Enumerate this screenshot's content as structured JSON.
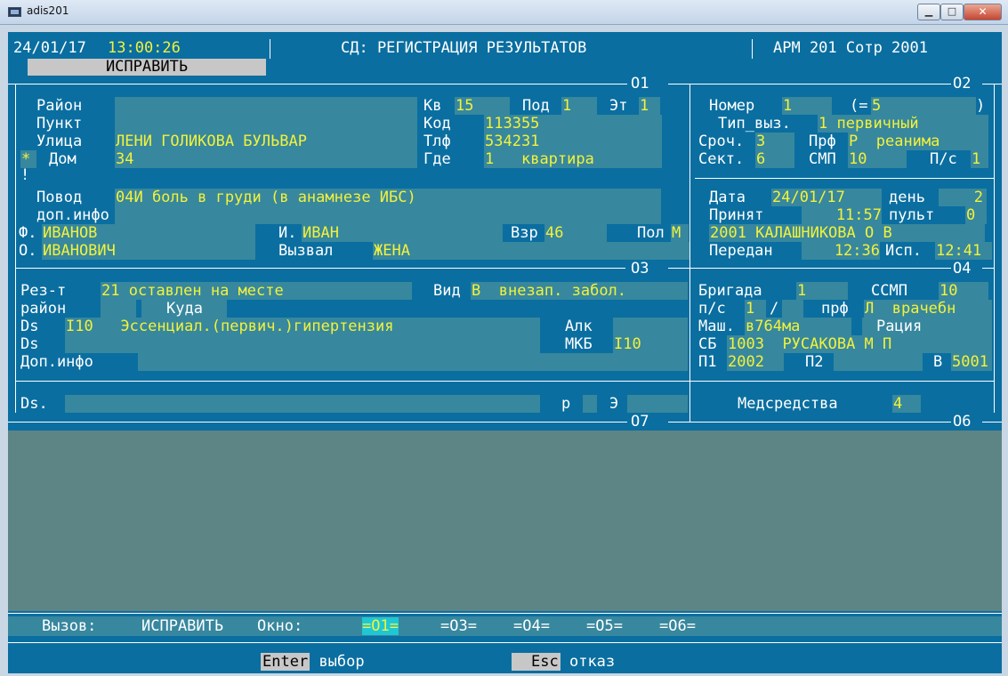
{
  "window": {
    "title": "adis201"
  },
  "header": {
    "date": "24/01/17",
    "time": "13:00:26",
    "mode": "СД: РЕГИСТРАЦИЯ РЕЗУЛЬТАТОВ",
    "workstation": "АРМ 201 Сотр 2001",
    "tab": "ИСПРАВИТЬ"
  },
  "windows": {
    "o1": "О1",
    "o2": "О2",
    "o3": "О3",
    "o4": "О4",
    "o6": "О6",
    "o7": "О7"
  },
  "o1": {
    "rayon_label": "Район",
    "kv_label": "Кв",
    "kv": "15",
    "pod_label": "Под",
    "pod": "1",
    "et_label": "Эт",
    "et": "1",
    "punkt_label": "Пункт",
    "kod_label": "Код",
    "kod": "113355",
    "ulica_label": "Улица",
    "ulica": "ЛЕНИ ГОЛИКОВА БУЛЬВАР",
    "tlf_label": "Тлф",
    "tlf": "534231",
    "star": "*",
    "dom_label": "Дом",
    "dom": "34",
    "gde_label": "Где",
    "gde_code": "1",
    "gde": "квартира",
    "excl": "!",
    "povod_label": "Повод",
    "povod": "04И боль в груди (в анамнезе ИБС)",
    "dop_label": "доп.инфо",
    "f_label": "Ф.",
    "f": "ИВАНОВ",
    "i_label": "И.",
    "i": "ИВАН",
    "vzr_label": "Взр",
    "vzr": "46",
    "pol_label": "Пол",
    "pol": "М",
    "o_label": "О.",
    "o": "ИВАНОВИЧ",
    "vyzval_label": "Вызвал",
    "vyzval": "ЖЕНА"
  },
  "o2": {
    "nomer_label": "Номер",
    "nomer": "1",
    "eq_open": "(=",
    "eq_val": "5",
    "eq_close": ")",
    "tip_label": "Тип_выз.",
    "tip_code": "1",
    "tip": "первичный",
    "sroch_label": "Сроч.",
    "sroch": "3",
    "prf_label": "Прф",
    "prf_code": "Р",
    "prf": "реанима",
    "sekt_label": "Сект.",
    "sekt": "6",
    "smp_label": "СМП",
    "smp": "10",
    "ps_label": "П/с",
    "ps": "1",
    "data_label": "Дата",
    "data": "24/01/17",
    "den_label": "день",
    "den": "2",
    "prinyat_label": "Принят",
    "prinyat": "11:57",
    "pult_label": "пульт",
    "pult": "0",
    "operator": "2001 КАЛАШНИКОВА О В",
    "peredan_label": "Передан",
    "peredan": "12:36",
    "isp_label": "Исп.",
    "isp": "12:41"
  },
  "o3": {
    "rezt_label": "Рез-т",
    "rezt_code": "21",
    "rezt": "оставлен на месте",
    "vid_label": "Вид",
    "vid_code": "В",
    "vid": "внезап. забол.",
    "rayon_label": "район",
    "kuda_label": "Куда",
    "ds_label": "Ds",
    "ds_code": "I10",
    "ds": "Эссенциал.(первич.)гипертензия",
    "alk_label": "Алк",
    "ds2_label": "Ds",
    "mkb_label": "МКБ",
    "mkb": "I10",
    "dop_label": "Доп.инфо"
  },
  "o4": {
    "brigada_label": "Бригада",
    "brigada": "1",
    "ssmp_label": "ССМП",
    "ssmp": "10",
    "ps_label": "п/с",
    "ps": "1",
    "slash": "/",
    "prf_label": "прф",
    "prf_code": "Л",
    "prf": "врачебн",
    "mash_label": "Маш.",
    "mash": "в764ма",
    "raciya_label": "Рация",
    "sb_label": "СБ",
    "sb_code": "1003",
    "sb": "РУСАКОВА М П",
    "p1_label": "П1",
    "p1": "2002",
    "p2_label": "П2",
    "v_label": "В",
    "v": "5001"
  },
  "o7": {
    "ds_label": "Ds.",
    "r_label": "р",
    "e_label": "Э"
  },
  "o6": {
    "med_label": "Медсредства",
    "med": "4"
  },
  "statusbar": {
    "vyzov_label": "Вызов:",
    "vyzov": "ИСПРАВИТЬ",
    "okno_label": "Окно:",
    "okna": [
      "=О1=",
      "=О3=",
      "=О4=",
      "=О5=",
      "=О6="
    ]
  },
  "hints": {
    "enter_key": "Enter",
    "enter": "выбор",
    "esc_key": "Esc",
    "esc": "отказ"
  }
}
